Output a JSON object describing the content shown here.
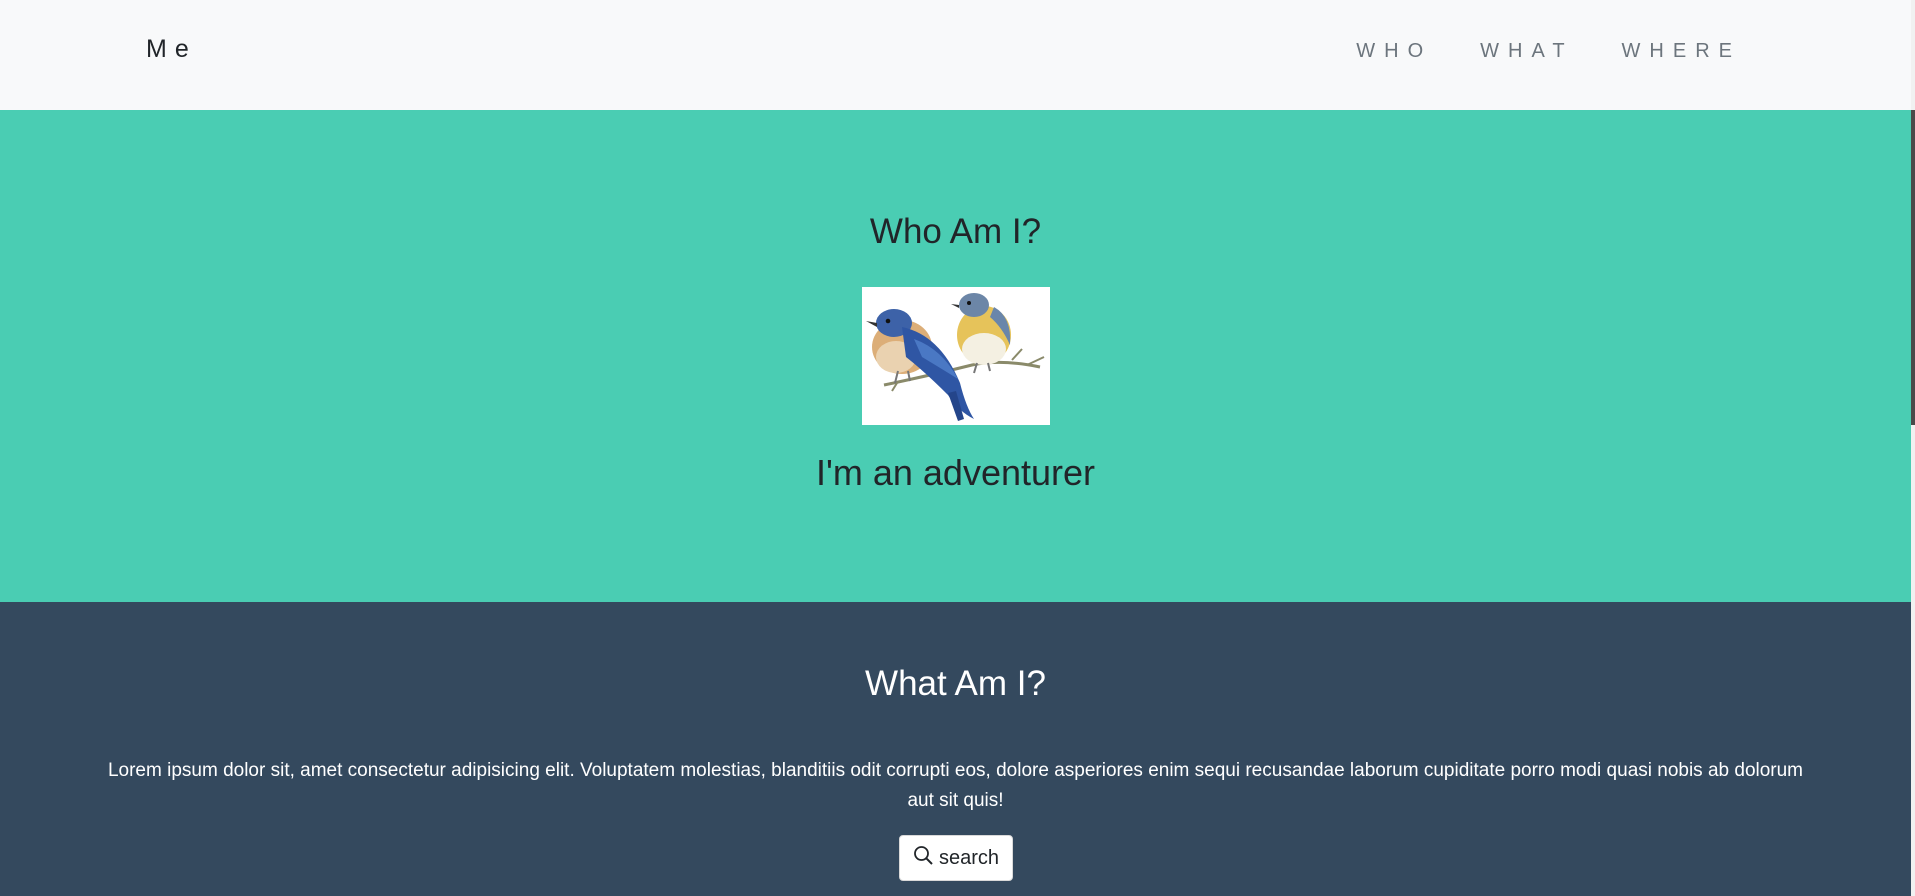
{
  "navbar": {
    "brand": "Me",
    "links": [
      "WHO",
      "WHAT",
      "WHERE"
    ]
  },
  "who": {
    "title": "Who Am I?",
    "image": "two-bluebirds-on-branch",
    "tagline": "I'm an adventurer",
    "background": "#4acdb3"
  },
  "what": {
    "title": "What Am I?",
    "paragraph": "Lorem ipsum dolor sit, amet consectetur adipisicing elit. Voluptatem molestias, blanditiis odit corrupti eos, dolore asperiores enim sequi recusandae laborum cupiditate porro modi quasi nobis ab dolorum aut sit quis!",
    "button_label": "search",
    "button_icon": "search-icon",
    "background": "#34495e"
  }
}
